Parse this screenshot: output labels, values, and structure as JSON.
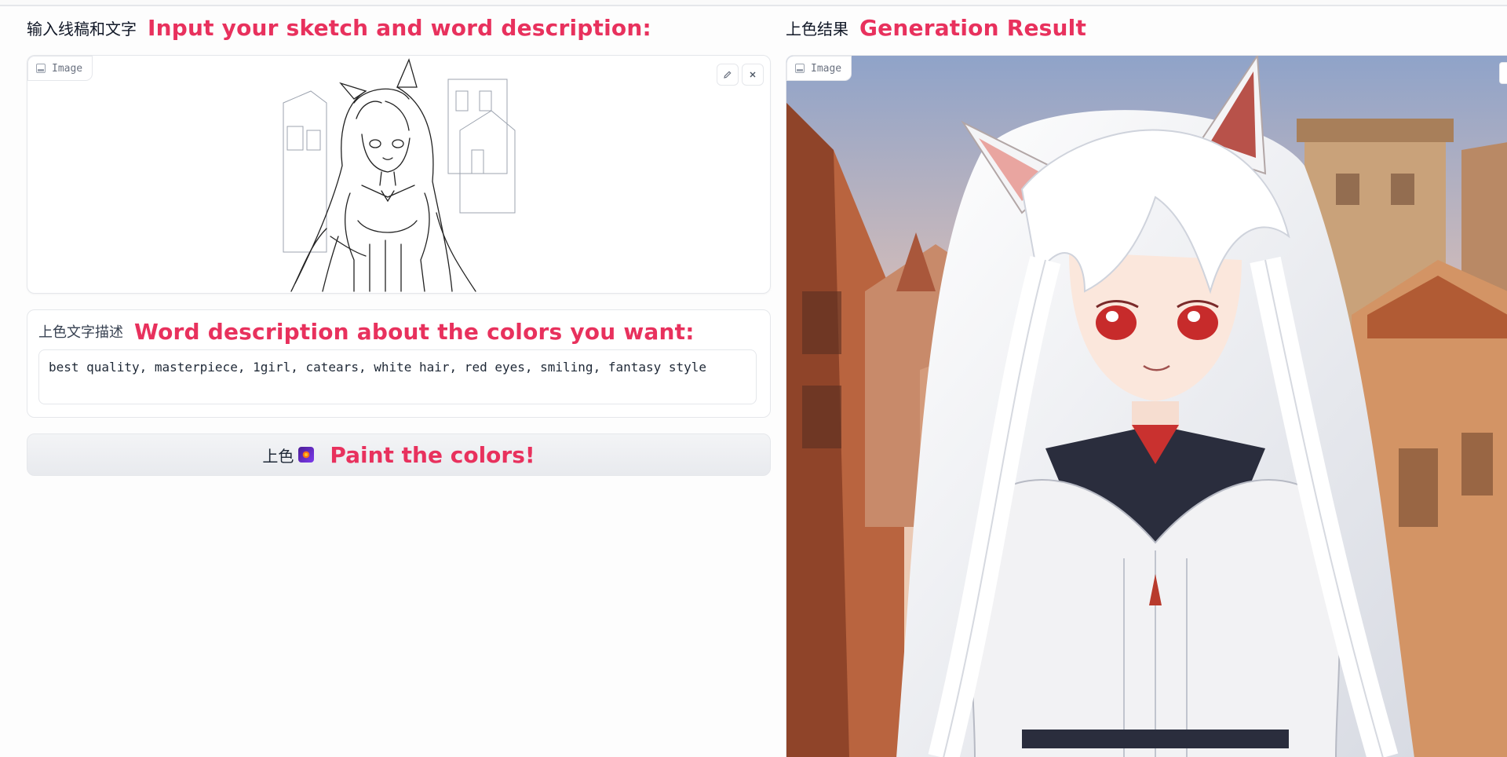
{
  "input_panel": {
    "heading_cn": "输入线稿和文字",
    "heading_en": "Input your sketch and word description:",
    "image_tag": "Image",
    "edit_icon": "pencil-icon",
    "clear_icon": "close-icon"
  },
  "prompt_panel": {
    "heading_cn": "上色文字描述",
    "heading_en": "Word description about the colors you want:",
    "value": "best quality, masterpiece, 1girl, catears, white hair, red eyes, smiling, fantasy style"
  },
  "paint_button": {
    "label_cn": "上色",
    "icon": "palette-icon",
    "label_en": "Paint the colors!"
  },
  "result_panel": {
    "heading_cn": "上色结果",
    "heading_en": "Generation Result",
    "image_tag": "Image"
  },
  "colors": {
    "accent": "#e8315d",
    "border": "#e5e7eb",
    "button_bg": "#eef0f3"
  }
}
